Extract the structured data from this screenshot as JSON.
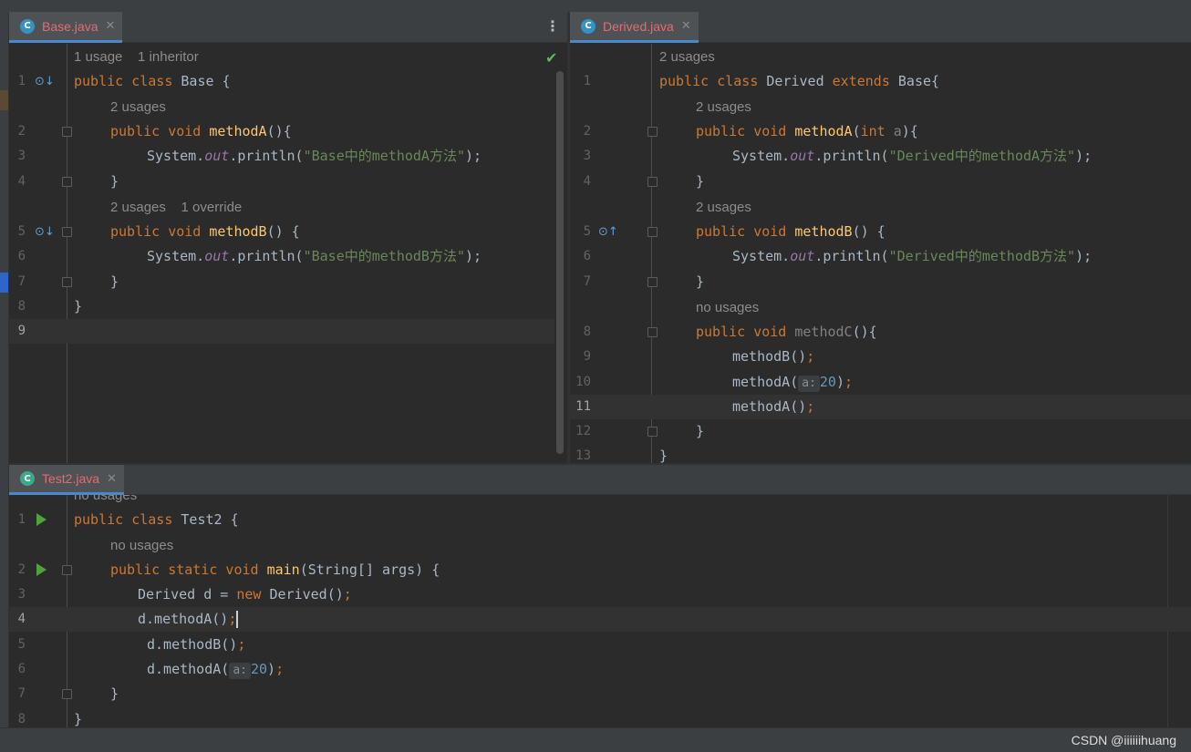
{
  "colors": {
    "keyword": "#cc7832",
    "method_decl": "#ffc66d",
    "string": "#6a8759",
    "static_field": "#9876aa",
    "number": "#6897bb",
    "hint": "#8c8c8c",
    "tab_active_name": "#e06c75",
    "tab_underline": "#4a88c7",
    "run_icon": "#4fa33a"
  },
  "icons": {
    "class_icon": "C",
    "close_icon": "✕",
    "more_icon": "⋮",
    "check_icon": "✔",
    "implemented_icon": "⊙↓",
    "overrides_icon": "⊙↑",
    "run_icon": "run-triangle"
  },
  "base_pane": {
    "tab": {
      "name": "Base.java",
      "icon": "C"
    },
    "hints": {
      "class_hint": "1 usage    1 inheritor",
      "methodA_hint": "2 usages",
      "methodB_hint": "2 usages    1 override"
    },
    "line_numbers": [
      "1",
      "2",
      "3",
      "4",
      "5",
      "6",
      "7",
      "8",
      "9"
    ],
    "code": {
      "l1_kw": "public class ",
      "l1_name": "Base {",
      "l2_kw": "public void ",
      "l2_fn": "methodA",
      "l2_rest": "(){",
      "l3_a": "System.",
      "l3_out": "out",
      "l3_b": ".println(",
      "l3_str": "\"Base中的methodA方法\"",
      "l3_end": ");",
      "l4": "}",
      "l5_kw": "public void ",
      "l5_fn": "methodB",
      "l5_rest": "() {",
      "l6_a": "System.",
      "l6_out": "out",
      "l6_b": ".println(",
      "l6_str": "\"Base中的methodB方法\"",
      "l6_end": ");",
      "l7": "}",
      "l8": "}"
    }
  },
  "derived_pane": {
    "tab": {
      "name": "Derived.java",
      "icon": "C"
    },
    "hints": {
      "class_hint": "2 usages",
      "methodA_hint": "2 usages",
      "methodB_hint": "2 usages",
      "methodC_hint": "no usages"
    },
    "line_numbers": [
      "1",
      "2",
      "3",
      "4",
      "5",
      "6",
      "7",
      "8",
      "9",
      "10",
      "11",
      "12",
      "13"
    ],
    "code": {
      "l1_kw": "public class ",
      "l1_name": "Derived ",
      "l1_kw2": "extends ",
      "l1_base": "Base{",
      "l2_kw": "public void ",
      "l2_fn": "methodA",
      "l2_p": "(",
      "l2_int": "int ",
      "l2_param": "a",
      "l2_end": "){",
      "l3_a": "System.",
      "l3_out": "out",
      "l3_b": ".println(",
      "l3_str": "\"Derived中的methodA方法\"",
      "l3_end": ");",
      "l4": "}",
      "l5_kw": "public void ",
      "l5_fn": "methodB",
      "l5_rest": "() {",
      "l6_a": "System.",
      "l6_out": "out",
      "l6_b": ".println(",
      "l6_str": "\"Derived中的methodB方法\"",
      "l6_end": ");",
      "l7": "}",
      "l8_kw": "public void ",
      "l8_fn": "methodC",
      "l8_rest": "(){",
      "l9_a": "methodB()",
      "l9_end": ";",
      "l10_a": "methodA(",
      "l10_hint": "a:",
      "l10_num": "20",
      "l10_b": ")",
      "l10_end": ";",
      "l11_a": "methodA()",
      "l11_end": ";",
      "l12": "}",
      "l13": "}"
    }
  },
  "test_pane": {
    "tab": {
      "name": "Test2.java",
      "icon": "C"
    },
    "hints": {
      "class_hint": "no usages",
      "main_hint": "no usages"
    },
    "line_numbers": [
      "1",
      "2",
      "3",
      "4",
      "5",
      "6",
      "7",
      "8"
    ],
    "code": {
      "l1_kw": "public class ",
      "l1_name": "Test2 {",
      "l2_kw": "public static void ",
      "l2_fn": "main",
      "l2_rest": "(String[] args) {",
      "l3_a": "Derived d = ",
      "l3_kw": "new ",
      "l3_b": "Derived()",
      "l3_end": ";",
      "l4_a": "d.methodA()",
      "l4_end": ";",
      "l5_a": "d.methodB()",
      "l5_end": ";",
      "l6_a": "d.methodA(",
      "l6_hint": "a:",
      "l6_num": "20",
      "l6_b": ")",
      "l6_end": ";",
      "l7": "}",
      "l8": "}"
    }
  },
  "status": {
    "watermark": "CSDN @iiiiiihuang"
  }
}
